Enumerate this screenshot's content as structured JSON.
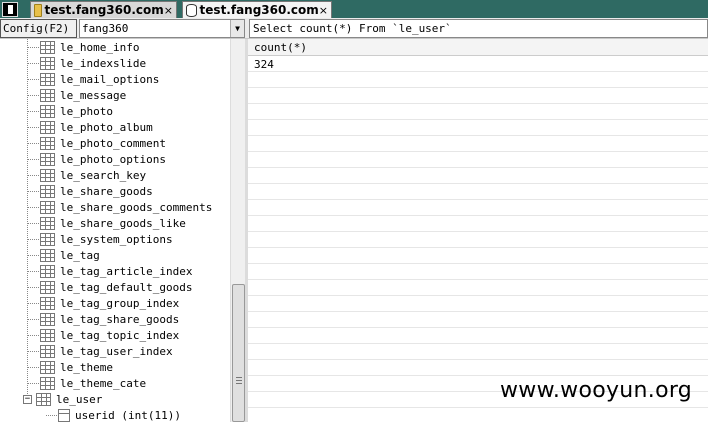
{
  "tabs": [
    {
      "label": "test.fang360.com",
      "close": "×",
      "icon": "folder-icon",
      "active": false
    },
    {
      "label": "test.fang360.com",
      "close": "×",
      "icon": "database-icon",
      "active": true
    }
  ],
  "toolbar": {
    "config_label": "Config(F2)",
    "database_selected": "fang360",
    "query_text": "Select count(*) From `le_user`"
  },
  "tree": {
    "tables": [
      "le_home_info",
      "le_indexslide",
      "le_mail_options",
      "le_message",
      "le_photo",
      "le_photo_album",
      "le_photo_comment",
      "le_photo_options",
      "le_search_key",
      "le_share_goods",
      "le_share_goods_comments",
      "le_share_goods_like",
      "le_system_options",
      "le_tag",
      "le_tag_article_index",
      "le_tag_default_goods",
      "le_tag_group_index",
      "le_tag_share_goods",
      "le_tag_topic_index",
      "le_tag_user_index",
      "le_theme",
      "le_theme_cate"
    ],
    "expanded_table": "le_user",
    "expander_symbol": "−",
    "columns": [
      "userid (int(11))"
    ]
  },
  "results": {
    "columns": [
      "count(*)"
    ],
    "rows": [
      [
        "324"
      ]
    ]
  },
  "watermark": "www.wooyun.org",
  "colors": {
    "tabbar": "#2f6a63",
    "folder": "#e8c04a"
  }
}
